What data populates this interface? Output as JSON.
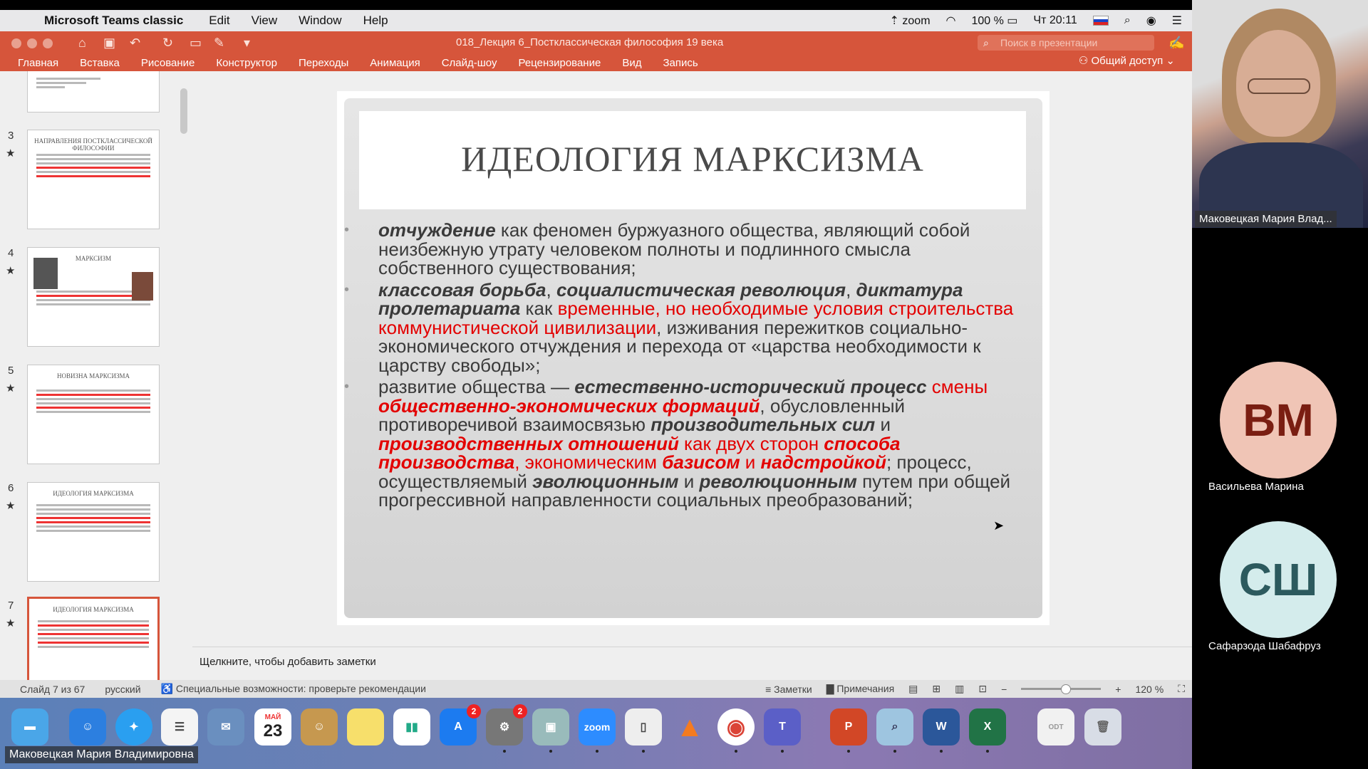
{
  "menubar": {
    "app": "Microsoft Teams classic",
    "items": [
      "Edit",
      "View",
      "Window",
      "Help"
    ],
    "zoom": "zoom",
    "battery": "100 %",
    "time": "Чт 20:11"
  },
  "powerpoint": {
    "doc_title": "018_Лекция 6_Постклассическая философия 19 века",
    "search_placeholder": "Поиск в презентации",
    "share": "Общий доступ",
    "tabs": [
      "Главная",
      "Вставка",
      "Рисование",
      "Конструктор",
      "Переходы",
      "Анимация",
      "Слайд-шоу",
      "Рецензирование",
      "Вид",
      "Запись"
    ]
  },
  "thumbnails": [
    {
      "num": "3",
      "title": "НАПРАВЛЕНИЯ ПОСТКЛАССИЧЕСКОЙ ФИЛОСОФИИ"
    },
    {
      "num": "4",
      "title": "МАРКСИЗМ"
    },
    {
      "num": "5",
      "title": "НОВИЗНА МАРКСИЗМА"
    },
    {
      "num": "6",
      "title": "ИДЕОЛОГИЯ МАРКСИЗМА"
    },
    {
      "num": "7",
      "title": "ИДЕОЛОГИЯ МАРКСИЗМА"
    }
  ],
  "slide": {
    "title": "ИДЕОЛОГИЯ МАРКСИЗМА",
    "b1_bold": "отчуждение",
    "b1_text": " как феномен буржуазного общества, являющий собой неизбежную утрату человеком полноты и подлинного смысла собственного существования;",
    "b2_bold1": "классовая борьба",
    "b2_sep1": ", ",
    "b2_bold2": "социалистическая революция",
    "b2_sep2": ", ",
    "b2_bold3": "диктатура пролетариата",
    "b2_as": " как ",
    "b2_red": "временные, но необходимые условия строительства коммунистической цивилизации",
    "b2_text": ", изживания пережитков социально-экономического отчуждения и перехода от «царства необходимости к царству свободы»;",
    "b3_text1": "развитие общества — ",
    "b3_bold1": "естественно-исторический процесс",
    "b3_red1": " смены ",
    "b3_redbold1": "общественно-экономических формаций",
    "b3_text2": ", обусловленный противоречивой взаимосвязью ",
    "b3_bold2": "производительных сил",
    "b3_and": " и ",
    "b3_redbold2": "производственных отношений",
    "b3_red2": " как двух сторон ",
    "b3_redbold3": "способа производства",
    "b3_red3": ", экономическим ",
    "b3_redbold4": "базисом",
    "b3_red4": " и ",
    "b3_redbold5": "надстройкой",
    "b3_text3": "; процесс, осуществляемый ",
    "b3_bold3": "эволюционным",
    "b3_and2": " и ",
    "b3_bold4": "революционным",
    "b3_text4": " путем при общей прогрессивной направленности социальных преобразований;"
  },
  "notes_placeholder": "Щелкните, чтобы добавить заметки",
  "status": {
    "slide": "Слайд 7 из 67",
    "lang": "русский",
    "accessibility": "Специальные возможности: проверьте рекомендации",
    "notes": "Заметки",
    "comments": "Примечания",
    "zoom": "120 %"
  },
  "dock": {
    "calendar_month": "МАЙ",
    "calendar_day": "23",
    "zoom_label": "zoom",
    "badge_appstore": "2",
    "badge_settings": "2"
  },
  "presenter_label": "Маковецкая Мария Владимировна",
  "participants": {
    "video_name": "Маковецкая Мария Влад...",
    "p1_initials": "ВМ",
    "p1_name": "Васильева Марина",
    "p2_initials": "СШ",
    "p2_name": "Сафарзода Шабафруз"
  },
  "colors": {
    "ppt_accent": "#d6553b",
    "slide_red": "#e30000",
    "avatar1_bg": "#f0c5b6",
    "avatar2_bg": "#d4ecec"
  }
}
